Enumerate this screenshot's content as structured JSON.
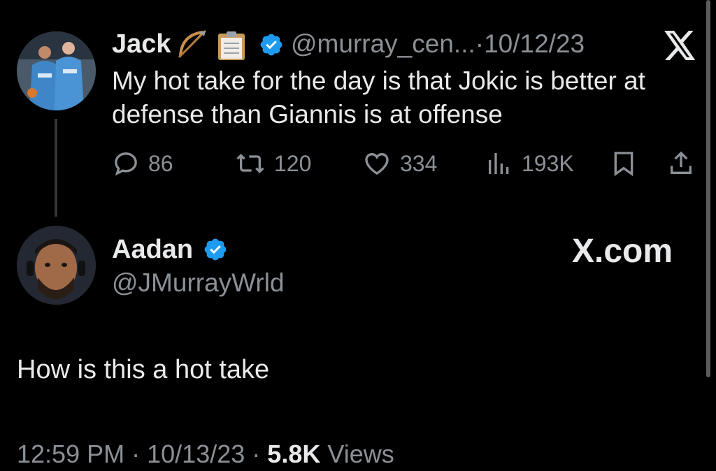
{
  "parent_tweet": {
    "author_name": "Jack",
    "name_emojis": "🏹📋",
    "handle": "@murray_cen...",
    "separator": "·",
    "date": "10/12/23",
    "text": "My hot take for the day is that Jokic is better at defense than Giannis is at offense",
    "replies": "86",
    "retweets": "120",
    "likes": "334",
    "views": "193K"
  },
  "reply_tweet": {
    "author_name": "Aadan",
    "handle": "@JMurrayWrld",
    "source": "X.com",
    "text": "How is this a hot take",
    "time": "12:59 PM",
    "date": "10/13/23",
    "views_count": "5.8K",
    "views_label": "Views",
    "dot": "·"
  },
  "colors": {
    "background": "#000000",
    "primary_text": "#e7e9ea",
    "secondary_text": "#8b9096",
    "verified_blue": "#1d9bf0"
  },
  "icons": [
    "x-logo-icon",
    "verified-badge-icon",
    "reply-icon",
    "retweet-icon",
    "like-icon",
    "views-icon",
    "bookmark-icon",
    "share-icon"
  ]
}
